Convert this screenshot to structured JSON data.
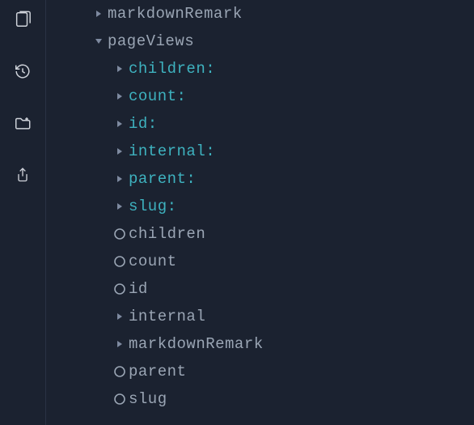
{
  "sidebar_icons": {
    "explorer": "explorer-icon",
    "history": "history-icon",
    "folder": "folder-icon",
    "share": "share-icon"
  },
  "tree": {
    "lv1": [
      {
        "label": "markdownRemark",
        "marker": "tri-right",
        "teal": false
      },
      {
        "label": "pageViews",
        "marker": "tri-down",
        "teal": false
      }
    ],
    "lv2_fields": [
      {
        "label": "children:",
        "marker": "tri-right",
        "teal": true
      },
      {
        "label": "count:",
        "marker": "tri-right",
        "teal": true
      },
      {
        "label": "id:",
        "marker": "tri-right",
        "teal": true
      },
      {
        "label": "internal:",
        "marker": "tri-right",
        "teal": true
      },
      {
        "label": "parent:",
        "marker": "tri-right",
        "teal": true
      },
      {
        "label": "slug:",
        "marker": "tri-right",
        "teal": true
      }
    ],
    "lv2_items": [
      {
        "label": "children",
        "marker": "circle",
        "teal": false
      },
      {
        "label": "count",
        "marker": "circle",
        "teal": false
      },
      {
        "label": "id",
        "marker": "circle",
        "teal": false
      },
      {
        "label": "internal",
        "marker": "tri-right",
        "teal": false
      },
      {
        "label": "markdownRemark",
        "marker": "tri-right",
        "teal": false
      },
      {
        "label": "parent",
        "marker": "circle",
        "teal": false
      },
      {
        "label": "slug",
        "marker": "circle",
        "teal": false
      }
    ]
  }
}
